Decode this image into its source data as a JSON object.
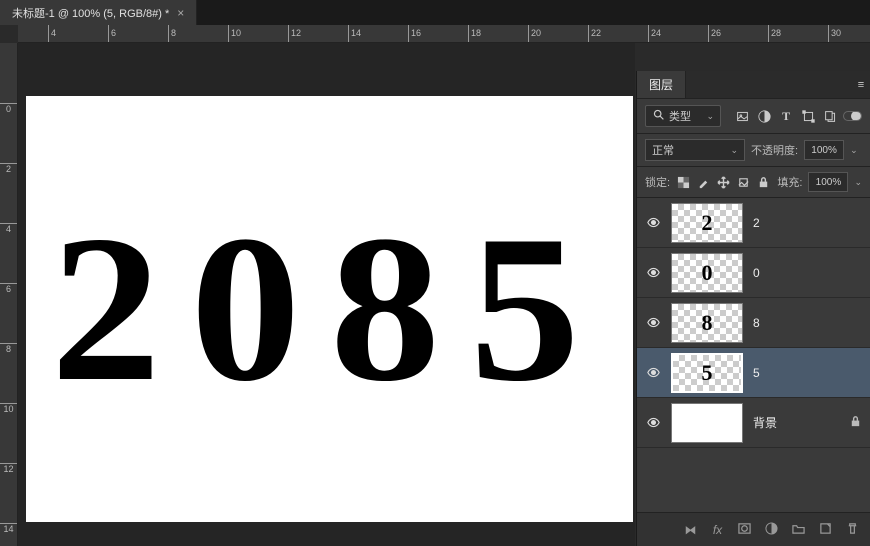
{
  "tab": {
    "title": "未标题-1 @ 100% (5, RGB/8#) *",
    "close": "×"
  },
  "canvas": {
    "text": "2085"
  },
  "ruler_h": [
    "4",
    "6",
    "8",
    "10",
    "12",
    "14",
    "16",
    "18",
    "20",
    "22",
    "24",
    "26",
    "28",
    "30"
  ],
  "ruler_v": [
    "0",
    "2",
    "4",
    "6",
    "8",
    "10",
    "12",
    "14"
  ],
  "panel": {
    "tab_label": "图层",
    "filter_label": "类型",
    "blend": "正常",
    "opacity_label": "不透明度:",
    "opacity_value": "100%",
    "lock_label": "锁定:",
    "fill_label": "填充:",
    "fill_value": "100%"
  },
  "layers": [
    {
      "content": "2",
      "name": "2",
      "selected": false,
      "checker": true
    },
    {
      "content": "0",
      "name": "0",
      "selected": false,
      "checker": true
    },
    {
      "content": "8",
      "name": "8",
      "selected": false,
      "checker": true
    },
    {
      "content": "5",
      "name": "5",
      "selected": true,
      "checker": true
    },
    {
      "content": "",
      "name": "背景",
      "selected": false,
      "checker": false,
      "locked": true
    }
  ],
  "bottom_fx": "fx"
}
